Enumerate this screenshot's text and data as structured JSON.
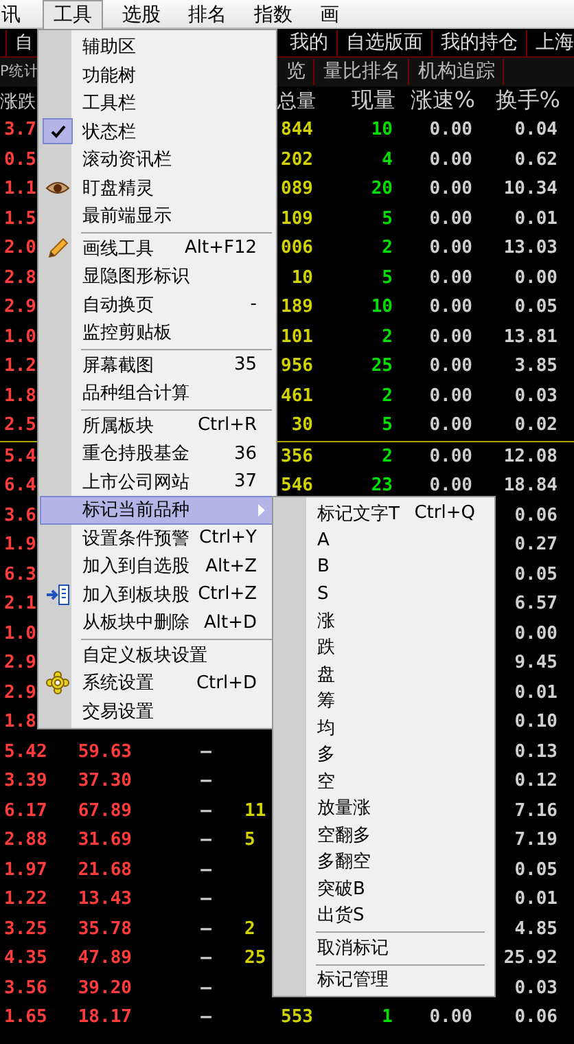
{
  "menubar": [
    {
      "label": "讯",
      "selected": false
    },
    {
      "label": "工具",
      "selected": true
    },
    {
      "label": "选股",
      "selected": false
    },
    {
      "label": "排名",
      "selected": false
    },
    {
      "label": "指数",
      "selected": false
    },
    {
      "label": "画",
      "selected": false
    }
  ],
  "tab_bar": [
    {
      "label": "自"
    },
    {
      "label": "我的"
    },
    {
      "label": "自选版面"
    },
    {
      "label": "我的持仓"
    },
    {
      "label": "上海"
    }
  ],
  "sub_tabs": [
    {
      "label": "P统计"
    },
    {
      "label": "览"
    },
    {
      "label": "量比排名"
    },
    {
      "label": "机构追踪"
    }
  ],
  "table": {
    "columns": {
      "column_1": "涨跌",
      "column_4": "总量",
      "column_5": "现量",
      "column_6": "涨速%",
      "column_7": "换手%"
    },
    "row_groups": [
      [
        {
          "kind": "full",
          "column_1": "3.7",
          "column_4": "844",
          "column_5": "10",
          "column_6": "0.00",
          "column_7": "0.04"
        },
        {
          "kind": "full",
          "column_1": "0.5",
          "column_4": "202",
          "column_5": "4",
          "column_6": "0.00",
          "column_7": "0.62"
        },
        {
          "kind": "full",
          "column_1": "1.1",
          "column_4": "089",
          "column_5": "20",
          "column_6": "0.00",
          "column_7": "10.34"
        },
        {
          "kind": "full",
          "column_1": "1.5",
          "column_4": "109",
          "column_5": "5",
          "column_6": "0.00",
          "column_7": "0.01"
        },
        {
          "kind": "full",
          "column_1": "2.0",
          "column_4": "006",
          "column_5": "2",
          "column_6": "0.00",
          "column_7": "13.03"
        },
        {
          "kind": "full",
          "column_1": "2.8",
          "column_4": "10",
          "column_5": "5",
          "column_6": "0.00",
          "column_7": "0.00"
        },
        {
          "kind": "full",
          "column_1": "2.9",
          "column_4": "189",
          "column_5": "10",
          "column_6": "0.00",
          "column_7": "0.05"
        },
        {
          "kind": "full",
          "column_1": "1.0",
          "column_4": "101",
          "column_5": "2",
          "column_6": "0.00",
          "column_7": "13.81"
        },
        {
          "kind": "full",
          "column_1": "1.2",
          "column_4": "956",
          "column_5": "25",
          "column_6": "0.00",
          "column_7": "3.85"
        },
        {
          "kind": "full",
          "column_1": "1.8",
          "column_4": "461",
          "column_5": "2",
          "column_6": "0.00",
          "column_7": "0.03"
        },
        {
          "kind": "full",
          "column_1": "2.5",
          "column_4": "30",
          "column_5": "5",
          "column_6": "0.00",
          "column_7": "0.02"
        }
      ],
      [
        {
          "kind": "full",
          "column_1": "5.4",
          "column_4": "356",
          "column_5": "2",
          "column_6": "0.00",
          "column_7": "12.08"
        },
        {
          "kind": "full",
          "column_1": "6.4",
          "column_4": "546",
          "column_5": "23",
          "column_6": "0.00",
          "column_7": "18.84"
        },
        {
          "kind": "covered",
          "column_1": "3.6",
          "column_7": "0.06"
        },
        {
          "kind": "covered",
          "column_1": "1.9",
          "column_7": "0.27"
        },
        {
          "kind": "covered",
          "column_1": "6.3",
          "column_7": "0.05"
        },
        {
          "kind": "covered",
          "column_1": "2.1",
          "column_7": "6.57"
        },
        {
          "kind": "covered",
          "column_1": "1.0",
          "column_7": "0.00"
        },
        {
          "kind": "covered",
          "column_1": "2.9",
          "column_7": "9.45"
        },
        {
          "kind": "covered",
          "column_1": "2.9",
          "column_7": "0.01"
        },
        {
          "kind": "covered",
          "column_1": "1.8",
          "column_7": "0.10"
        },
        {
          "kind": "covered",
          "column_1": "5.42",
          "column_2": "59.63",
          "column_3": "—",
          "column_7": "0.13"
        },
        {
          "kind": "covered",
          "column_1": "3.39",
          "column_2": "37.30",
          "column_3": "—",
          "column_7": "0.12"
        },
        {
          "kind": "covered",
          "column_1": "6.17",
          "column_2": "67.89",
          "column_3": "—",
          "column_4": "11",
          "column_7": "7.16"
        },
        {
          "kind": "covered",
          "column_1": "2.88",
          "column_2": "31.69",
          "column_3": "—",
          "column_4": "5",
          "column_7": "7.19"
        },
        {
          "kind": "covered",
          "column_1": "1.97",
          "column_2": "21.68",
          "column_3": "—",
          "column_7": "0.05"
        },
        {
          "kind": "covered",
          "column_1": "1.22",
          "column_2": "13.43",
          "column_3": "—",
          "column_7": "0.01"
        },
        {
          "kind": "covered",
          "column_1": "3.25",
          "column_2": "35.78",
          "column_3": "—",
          "column_4": "2",
          "column_7": "4.85"
        },
        {
          "kind": "covered",
          "column_1": "4.35",
          "column_2": "47.89",
          "column_3": "—",
          "column_4": "25",
          "column_7": "25.92"
        },
        {
          "kind": "covered",
          "column_1": "3.56",
          "column_2": "39.20",
          "column_3": "—",
          "column_7": "0.03"
        },
        {
          "kind": "full",
          "column_1": "1.65",
          "column_2": "18.17",
          "column_3": "—",
          "column_4": "553",
          "column_5": "1",
          "column_6": "0.00",
          "column_7": "0.06"
        }
      ]
    ]
  },
  "tools_menu": {
    "items": [
      {
        "kind": "item",
        "label": "辅助区",
        "checked": false,
        "selected": false,
        "submenu": false
      },
      {
        "kind": "item",
        "label": "功能树",
        "checked": false,
        "selected": false,
        "submenu": false
      },
      {
        "kind": "item",
        "label": "工具栏",
        "checked": false,
        "selected": false,
        "submenu": false
      },
      {
        "kind": "item",
        "label": "状态栏",
        "checked": true,
        "selected": false,
        "submenu": false
      },
      {
        "kind": "item",
        "label": "滚动资讯栏",
        "checked": false,
        "selected": false,
        "submenu": false
      },
      {
        "kind": "item",
        "label": "盯盘精灵",
        "checked": false,
        "selected": false,
        "submenu": false
      },
      {
        "kind": "item",
        "label": "最前端显示",
        "checked": false,
        "selected": false,
        "submenu": false
      },
      {
        "kind": "separator"
      },
      {
        "kind": "item",
        "label": "画线工具",
        "shortcut": "Alt+F12",
        "checked": false,
        "selected": false,
        "submenu": false
      },
      {
        "kind": "item",
        "label": "显隐图形标识",
        "checked": false,
        "selected": false,
        "submenu": false
      },
      {
        "kind": "item",
        "label": "自动换页",
        "shortcut": "-",
        "checked": false,
        "selected": false,
        "submenu": false
      },
      {
        "kind": "item",
        "label": "监控剪贴板",
        "checked": false,
        "selected": false,
        "submenu": false
      },
      {
        "kind": "separator"
      },
      {
        "kind": "item",
        "label": "屏幕截图",
        "shortcut": "35",
        "checked": false,
        "selected": false,
        "submenu": false
      },
      {
        "kind": "item",
        "label": "品种组合计算",
        "checked": false,
        "selected": false,
        "submenu": false
      },
      {
        "kind": "separator"
      },
      {
        "kind": "item",
        "label": "所属板块",
        "shortcut": "Ctrl+R",
        "checked": false,
        "selected": false,
        "submenu": false
      },
      {
        "kind": "item",
        "label": "重仓持股基金",
        "shortcut": "36",
        "checked": false,
        "selected": false,
        "submenu": false
      },
      {
        "kind": "item",
        "label": "上市公司网站",
        "shortcut": "37",
        "checked": false,
        "selected": false,
        "submenu": false
      },
      {
        "kind": "item",
        "label": "标记当前品种",
        "checked": false,
        "selected": true,
        "submenu": true
      },
      {
        "kind": "item",
        "label": "设置条件预警",
        "shortcut": "Ctrl+Y",
        "checked": false,
        "selected": false,
        "submenu": false
      },
      {
        "kind": "item",
        "label": "加入到自选股",
        "shortcut": "Alt+Z",
        "checked": false,
        "selected": false,
        "submenu": false
      },
      {
        "kind": "item",
        "label": "加入到板块股",
        "shortcut": "Ctrl+Z",
        "checked": false,
        "selected": false,
        "submenu": false
      },
      {
        "kind": "item",
        "label": "从板块中删除",
        "shortcut": "Alt+D",
        "checked": false,
        "selected": false,
        "submenu": false
      },
      {
        "kind": "separator"
      },
      {
        "kind": "item",
        "label": "自定义板块设置",
        "checked": false,
        "selected": false,
        "submenu": false
      },
      {
        "kind": "item",
        "label": "系统设置",
        "shortcut": "Ctrl+D",
        "checked": false,
        "selected": false,
        "submenu": false
      },
      {
        "kind": "item",
        "label": "交易设置",
        "checked": false,
        "selected": false,
        "submenu": false
      }
    ]
  },
  "mark_submenu": {
    "items": [
      {
        "kind": "item",
        "label": "标记文字T",
        "shortcut": "Ctrl+Q"
      },
      {
        "kind": "item",
        "label": "A"
      },
      {
        "kind": "item",
        "label": "B"
      },
      {
        "kind": "item",
        "label": "S"
      },
      {
        "kind": "item",
        "label": "涨"
      },
      {
        "kind": "item",
        "label": "跌"
      },
      {
        "kind": "item",
        "label": "盘"
      },
      {
        "kind": "item",
        "label": "筹"
      },
      {
        "kind": "item",
        "label": "均"
      },
      {
        "kind": "item",
        "label": "多"
      },
      {
        "kind": "item",
        "label": "空"
      },
      {
        "kind": "item",
        "label": "放量涨"
      },
      {
        "kind": "item",
        "label": "空翻多"
      },
      {
        "kind": "item",
        "label": "多翻空"
      },
      {
        "kind": "item",
        "label": "突破B"
      },
      {
        "kind": "item",
        "label": "出货S"
      },
      {
        "kind": "separator"
      },
      {
        "kind": "item",
        "label": "取消标记"
      },
      {
        "kind": "separator"
      },
      {
        "kind": "item",
        "label": "标记管理"
      }
    ]
  }
}
